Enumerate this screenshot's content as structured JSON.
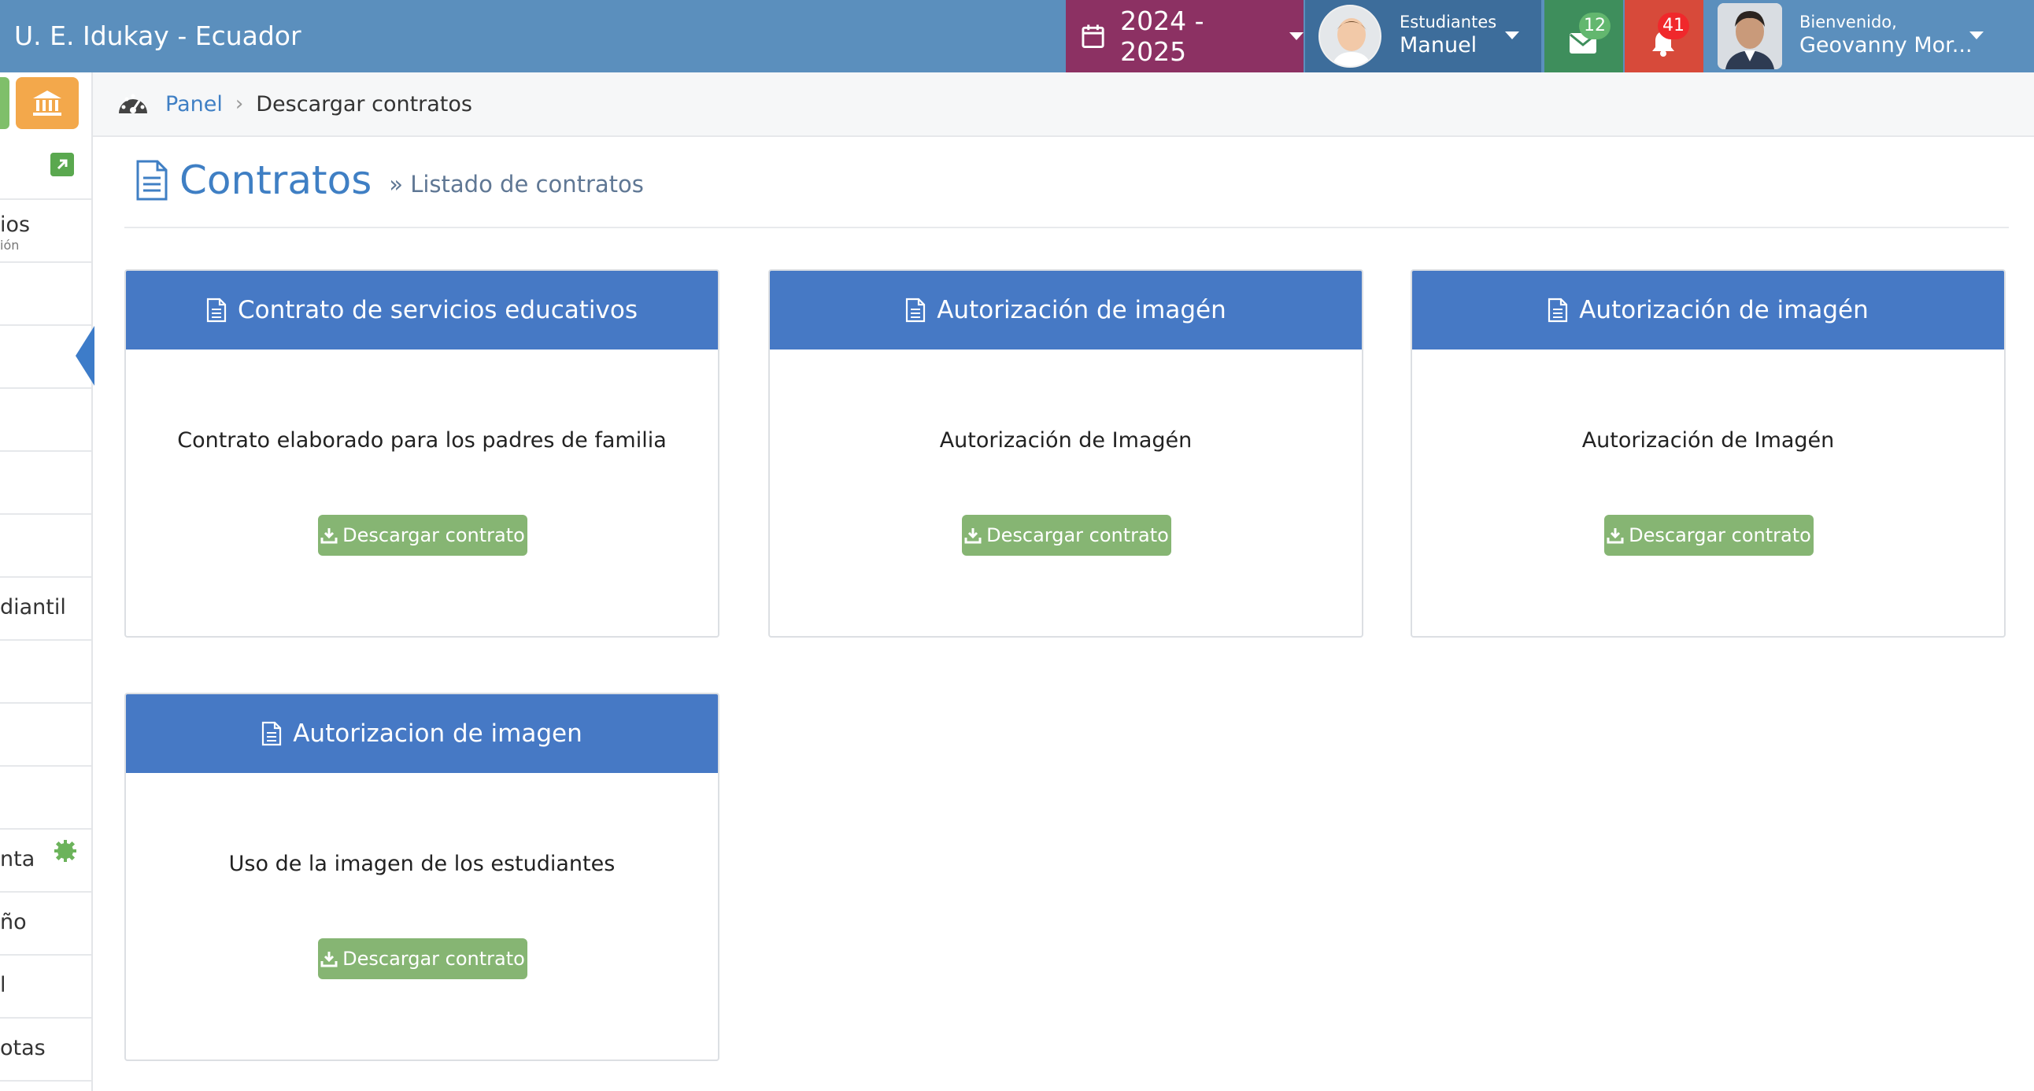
{
  "topbar": {
    "brand": "U. E. Idukay - Ecuador",
    "school_year": "2024 - 2025",
    "students_label": "Estudiantes",
    "student_name": "Manuel",
    "messages_count": "12",
    "notifications_count": "41",
    "welcome_label": "Bienvenido,",
    "user_name": "Geovanny Mor..."
  },
  "sidebar": {
    "items": [
      {
        "label": "ios",
        "sublabel": "ión"
      },
      {
        "label": "diantil"
      },
      {
        "label": "nta"
      },
      {
        "label": "ño"
      },
      {
        "label": "l"
      },
      {
        "label": "otas"
      }
    ]
  },
  "breadcrumb": {
    "home": "Panel",
    "separator": "›",
    "current": "Descargar contratos"
  },
  "page": {
    "title": "Contratos",
    "subtitle": "» Listado de contratos"
  },
  "cards": [
    {
      "title": "Contrato de servicios educativos",
      "description": "Contrato elaborado para los padres de familia",
      "button": "Descargar contrato"
    },
    {
      "title": "Autorización de imagén",
      "description": "Autorización de Imagén",
      "button": "Descargar contrato"
    },
    {
      "title": "Autorización de imagén",
      "description": "Autorización de Imagén",
      "button": "Descargar contrato"
    },
    {
      "title": "Autorizacion de imagen",
      "description": "Uso de la imagen de los estudiantes",
      "button": "Descargar contrato"
    }
  ],
  "colors": {
    "topbar": "#5b8fbd",
    "year_selector": "#8c3163",
    "students": "#3d6d9b",
    "messages": "#3e8e5c",
    "notifications": "#d74a3a",
    "card_header": "#4679c5",
    "download_button": "#86b573",
    "accent_text": "#3f7fc4"
  },
  "icons": [
    "calendar-icon",
    "envelope-icon",
    "bell-icon",
    "bank-icon",
    "dashboard-icon",
    "document-icon",
    "download-icon",
    "external-link-icon",
    "gear-icon"
  ]
}
